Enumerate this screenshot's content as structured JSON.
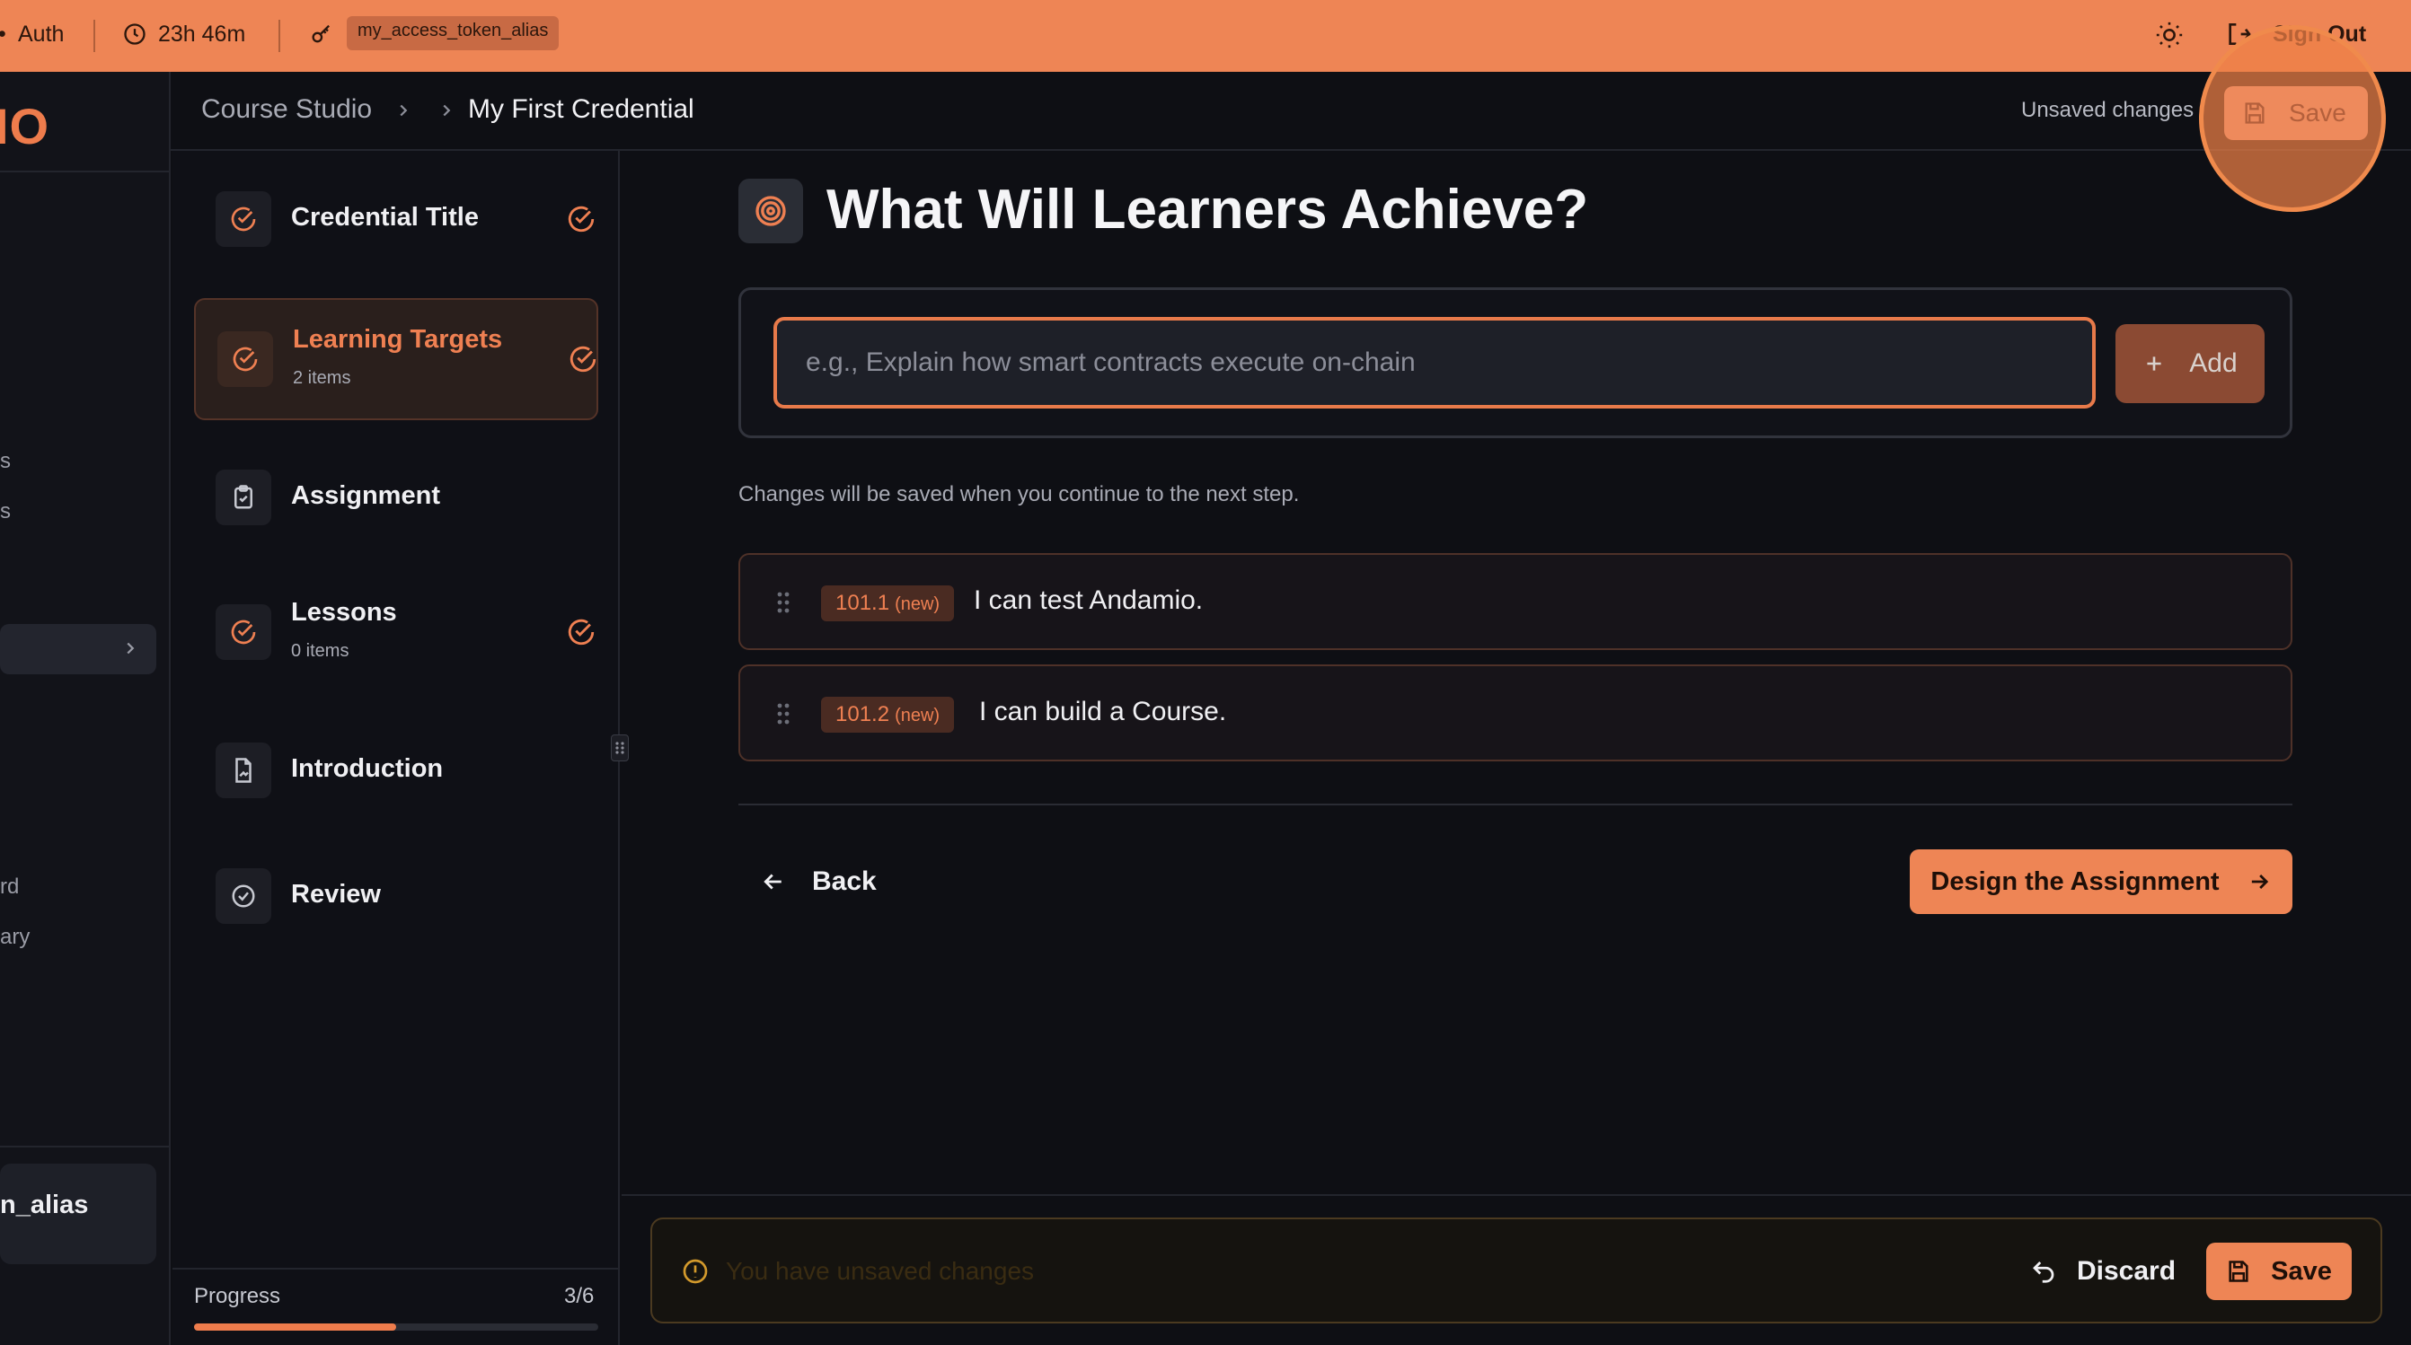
{
  "topbar": {
    "auth_label": "Auth",
    "session_time": "23h 46m",
    "token_alias": "my_access_token_alias",
    "sign_out_label": "Sign Out"
  },
  "app_sidebar": {
    "logo_text": "IO",
    "fragments": [
      "s",
      "s",
      "rd",
      "ary"
    ],
    "user_name_fragment": "n_alias"
  },
  "header": {
    "breadcrumb_parent": "Course Studio",
    "breadcrumb_current": "My First Credential",
    "unsaved_label": "Unsaved changes",
    "save_label": "Save"
  },
  "steps": [
    {
      "title": "Credential Title",
      "sub": "",
      "icon": "check-circle-icon",
      "done": true,
      "active": false
    },
    {
      "title": "Learning Targets",
      "sub": "2 items",
      "icon": "check-circle-icon",
      "done": true,
      "active": true
    },
    {
      "title": "Assignment",
      "sub": "",
      "icon": "clipboard-icon",
      "done": false,
      "active": false
    },
    {
      "title": "Lessons",
      "sub": "0 items",
      "icon": "check-circle-icon",
      "done": true,
      "active": false
    },
    {
      "title": "Introduction",
      "sub": "",
      "icon": "document-icon",
      "done": false,
      "active": false
    },
    {
      "title": "Review",
      "sub": "",
      "icon": "circle-check-icon",
      "done": false,
      "active": false
    }
  ],
  "progress": {
    "label": "Progress",
    "count_text": "3/6",
    "fraction": 0.5
  },
  "main": {
    "title": "What Will Learners Achieve?",
    "input_placeholder": "e.g., Explain how smart contracts execute on-chain",
    "input_value": "",
    "add_label": "Add",
    "hint": "Changes will be saved when you continue to the next step.",
    "targets": [
      {
        "code": "101.1",
        "tag": "(new)",
        "text": "I can test Andamio."
      },
      {
        "code": "101.2",
        "tag": "(new)",
        "text": "I can build a Course."
      }
    ],
    "back_label": "Back",
    "next_label": "Design the Assignment"
  },
  "bottom_bar": {
    "warning": "You have unsaved changes",
    "discard_label": "Discard",
    "save_label": "Save"
  },
  "colors": {
    "accent": "#ee8555",
    "background": "#0e0f14",
    "active_step_text": "#ef8052"
  }
}
